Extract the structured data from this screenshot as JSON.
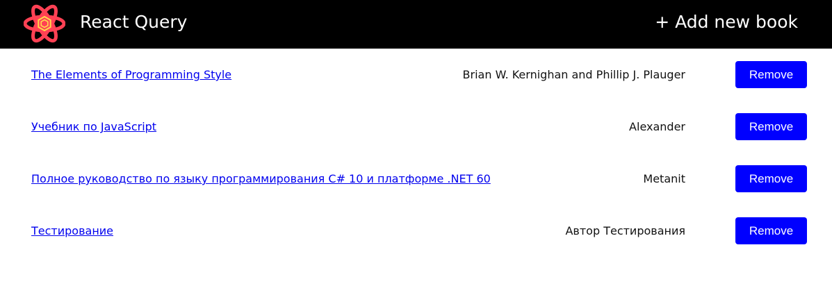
{
  "header": {
    "logo_icon": "react-query-logo-icon",
    "title": "React Query",
    "add_link_label": "+ Add new book",
    "background_color": "#000000"
  },
  "books": [
    {
      "title": "The Elements of Programming Style",
      "author": "Brian W. Kernighan and Phillip J. Plauger",
      "remove_label": "Remove"
    },
    {
      "title": "Учебник по JavaScript",
      "author": "Alexander",
      "remove_label": "Remove"
    },
    {
      "title": "Полное руководство по языку программирования C# 10 и платформе .NET 60",
      "author": "Metanit",
      "remove_label": "Remove"
    },
    {
      "title": "Тестирование",
      "author": "Автор Тестирования",
      "remove_label": "Remove"
    }
  ],
  "colors": {
    "link": "#0000ee",
    "button": "#0000ff",
    "logo_red": "#ff4154",
    "logo_yellow": "#ffd94c"
  }
}
